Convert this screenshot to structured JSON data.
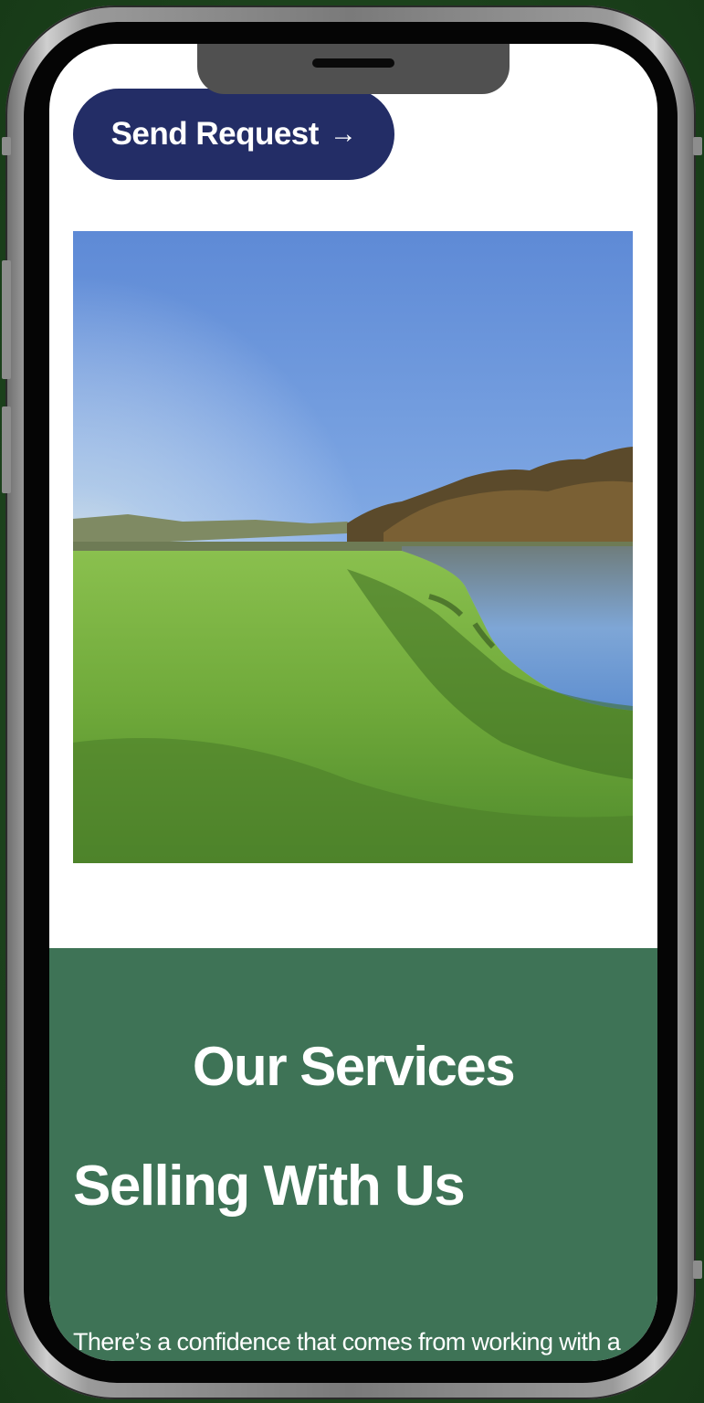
{
  "send_button": {
    "label": "Send Request",
    "arrow": "→"
  },
  "hero_image": {
    "subject": "riverside meadow under clear blue sky"
  },
  "services": {
    "heading": "Our Services",
    "title": "Selling With Us",
    "description": "There’s a confidence that comes from working with a team that truly understands the coastal and"
  },
  "colors": {
    "button": "#232d66",
    "services_bg": "#3e7356",
    "screen_bg": "#ffffff"
  }
}
